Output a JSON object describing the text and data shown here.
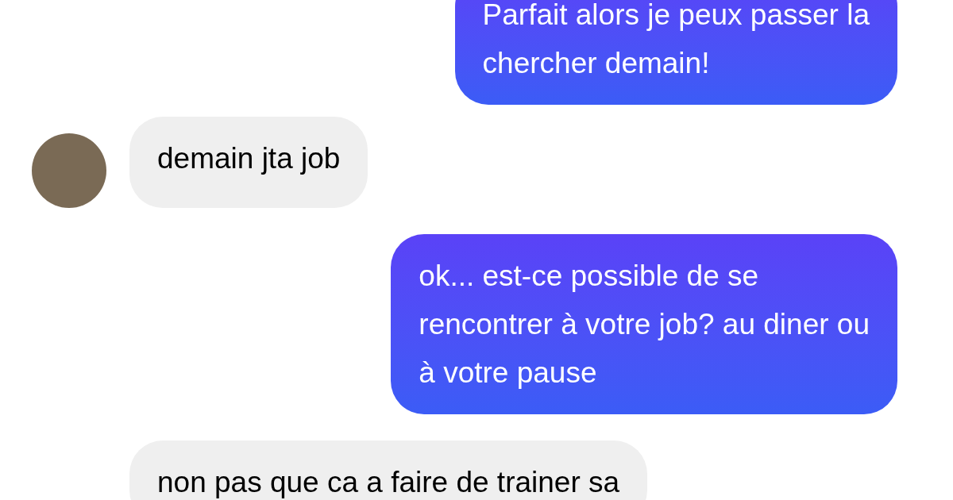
{
  "messages": [
    {
      "kind": "sent",
      "text": "Parfait alors je peux passer la\nchercher demain!"
    },
    {
      "kind": "received",
      "avatar": true,
      "text": "demain jta job"
    },
    {
      "kind": "sent",
      "text": "ok... est-ce possible de se\nrencontrer à votre job? au diner ou\nà votre pause"
    },
    {
      "kind": "received",
      "avatar": false,
      "text": "non pas que ca a faire de trainer sa"
    }
  ]
}
